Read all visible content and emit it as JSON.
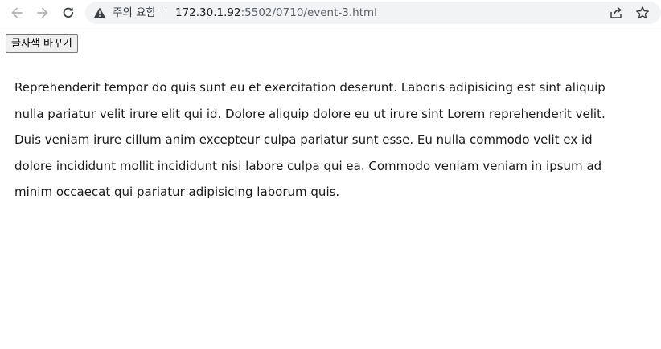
{
  "browser": {
    "security_label": "주의 요함",
    "url_host": "172.30.1.92",
    "url_path": ":5502/0710/event-3.html"
  },
  "page": {
    "button_label": "글자색 바꾸기",
    "paragraph": "Reprehenderit tempor do quis sunt eu et exercitation deserunt. Laboris adipisicing est sint aliquip nulla pariatur velit irure elit qui id. Dolore aliquip dolore eu ut irure sint Lorem reprehenderit velit. Duis veniam irure cillum anim excepteur culpa pariatur sunt esse. Eu nulla commodo velit ex id dolore incididunt mollit incididunt nisi labore culpa qui ea. Commodo veniam veniam in ipsum ad minim occaecat qui pariatur adipisicing laborum quis."
  },
  "icons": {
    "back": "back-arrow-icon",
    "forward": "forward-arrow-icon",
    "reload": "reload-icon",
    "warning": "warning-icon",
    "share": "share-icon",
    "bookmark": "star-icon"
  }
}
